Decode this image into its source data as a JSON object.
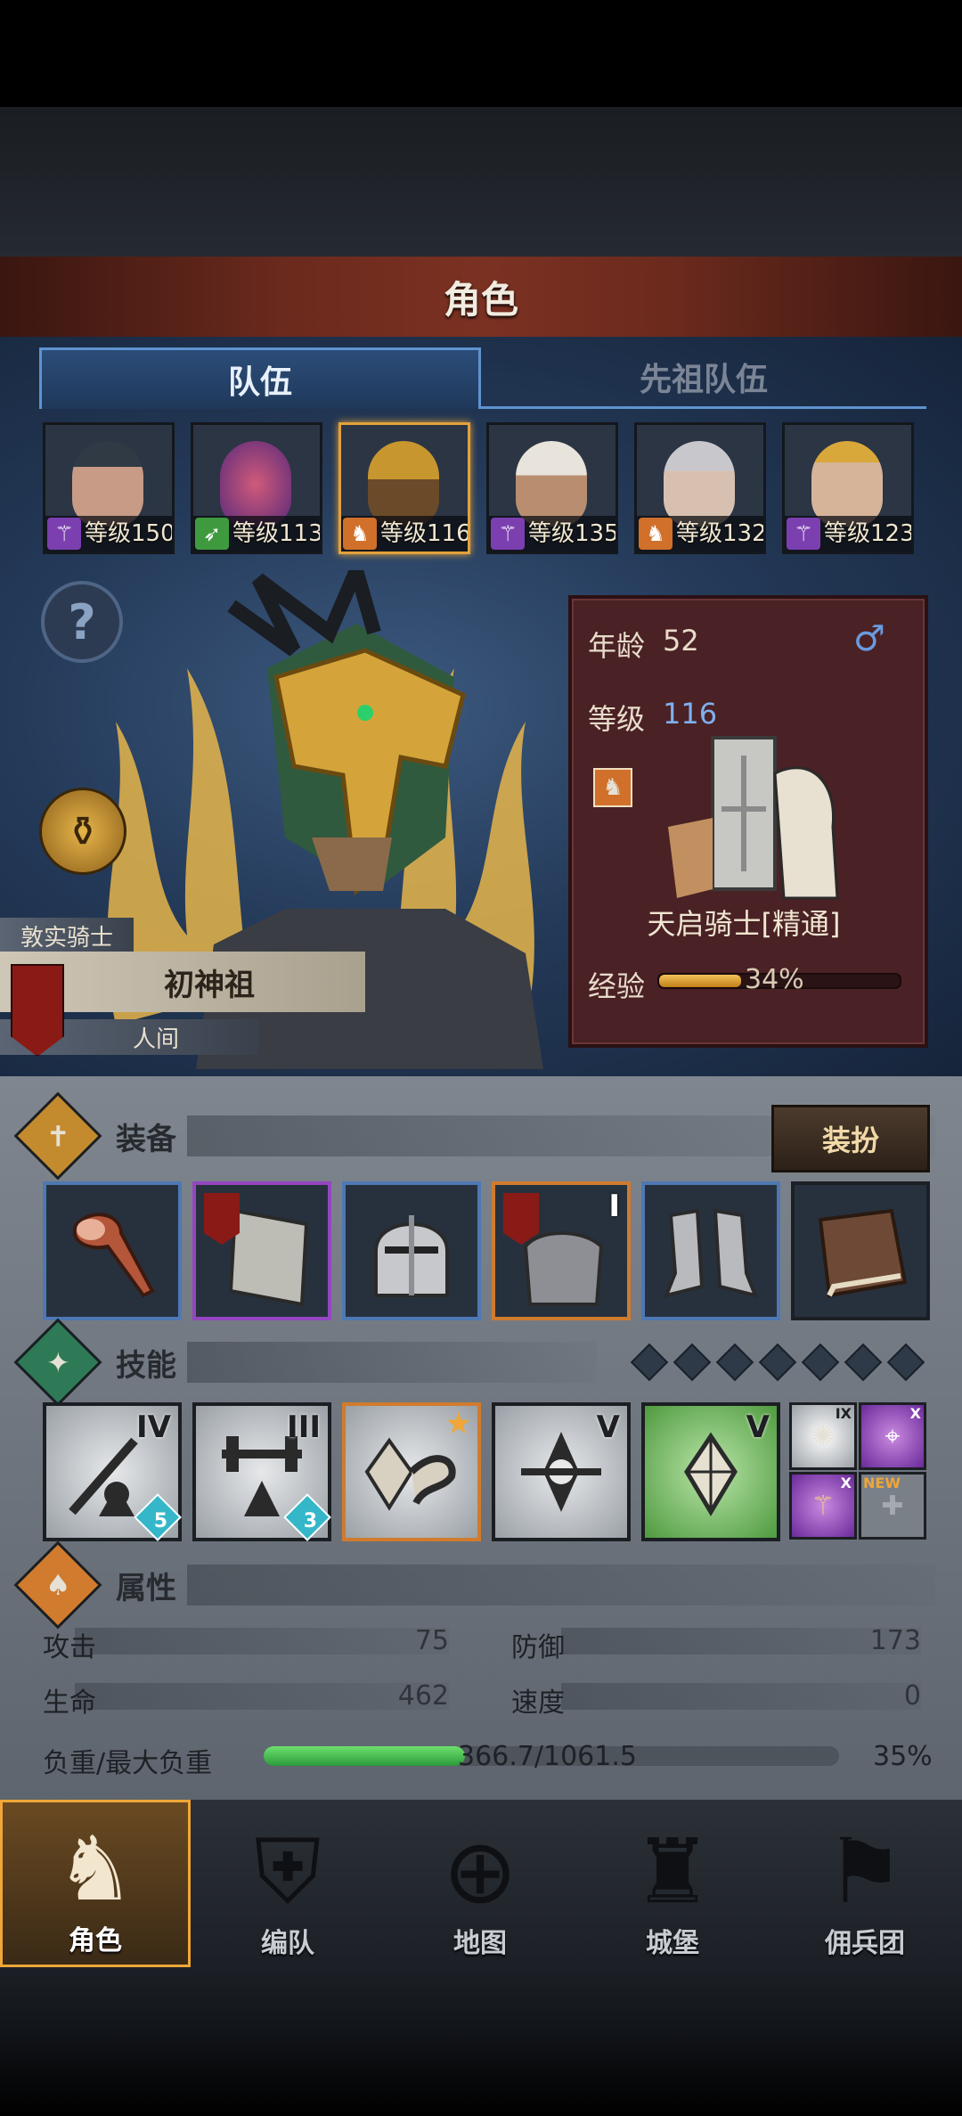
{
  "header": {
    "title": "角色"
  },
  "tabs": [
    {
      "label": "队伍",
      "active": true
    },
    {
      "label": "先祖队伍",
      "active": false
    }
  ],
  "team": [
    {
      "level_text": "等级150",
      "type_icon": "staff-icon",
      "type_color": "#7b3fb0"
    },
    {
      "level_text": "等级113",
      "type_icon": "bow-icon",
      "type_color": "#3f9a3f"
    },
    {
      "level_text": "等级116",
      "type_icon": "horse-icon",
      "type_color": "#d0702a",
      "selected": true
    },
    {
      "level_text": "等级135",
      "type_icon": "staff-icon",
      "type_color": "#7b3fb0"
    },
    {
      "level_text": "等级132",
      "type_icon": "horse-icon",
      "type_color": "#d0702a"
    },
    {
      "level_text": "等级123",
      "type_icon": "staff-icon",
      "type_color": "#7b3fb0"
    }
  ],
  "hero": {
    "title": "敦实骑士",
    "name": "初神祖",
    "race": "人间"
  },
  "info": {
    "age_label": "年龄",
    "age": "52",
    "gender_icon": "male-icon",
    "level_label": "等级",
    "level": "116",
    "class_name": "天启骑士[精通]",
    "exp_label": "经验",
    "exp_percent": "34%",
    "exp_fraction": 0.34
  },
  "equipment": {
    "title": "装备",
    "dress_button": "装扮",
    "slots": [
      {
        "icon": "meat-weapon-icon",
        "rarity": "blue"
      },
      {
        "icon": "tower-shield-icon",
        "rarity": "purple"
      },
      {
        "icon": "helmet-icon",
        "rarity": "blue"
      },
      {
        "icon": "armor-icon",
        "rarity": "orange",
        "roman": "I"
      },
      {
        "icon": "boots-icon",
        "rarity": "blue"
      },
      {
        "icon": "book-icon",
        "rarity": "dark"
      }
    ]
  },
  "skills": {
    "title": "技能",
    "items": [
      {
        "icon": "spear-shrine-icon",
        "roman": "IV",
        "gem": "5"
      },
      {
        "icon": "barbell-shrine-icon",
        "roman": "III",
        "gem": "3"
      },
      {
        "icon": "crystal-wing-icon",
        "star": true
      },
      {
        "icon": "crystal-cross-icon",
        "roman": "V"
      },
      {
        "icon": "crystal-plus-icon",
        "roman": "V"
      }
    ],
    "mini": [
      {
        "icon": "burst-icon",
        "roman": "IX"
      },
      {
        "icon": "target-icon",
        "roman": "X"
      },
      {
        "icon": "wand-icon",
        "roman": "X"
      },
      {
        "icon": "empty-slot-icon",
        "badge": "NEW"
      }
    ]
  },
  "attributes": {
    "title": "属性",
    "attack_label": "攻击",
    "attack": "75",
    "defense_label": "防御",
    "defense": "173",
    "hp_label": "生命",
    "hp": "462",
    "speed_label": "速度",
    "speed": "0",
    "load_label": "负重/最大负重",
    "load": "366.7/1061.5",
    "load_percent": "35%",
    "load_fraction": 0.35
  },
  "nav": [
    {
      "label": "角色",
      "icon": "knight-icon",
      "active": true
    },
    {
      "label": "编队",
      "icon": "helmet-flag-icon"
    },
    {
      "label": "地图",
      "icon": "compass-map-icon"
    },
    {
      "label": "城堡",
      "icon": "castle-icon"
    },
    {
      "label": "佣兵团",
      "icon": "mercenary-icon"
    }
  ],
  "colors": {
    "accent_gold": "#e3a13c",
    "tab_blue": "#5f93d0",
    "level_blue": "#7fb0ef"
  }
}
